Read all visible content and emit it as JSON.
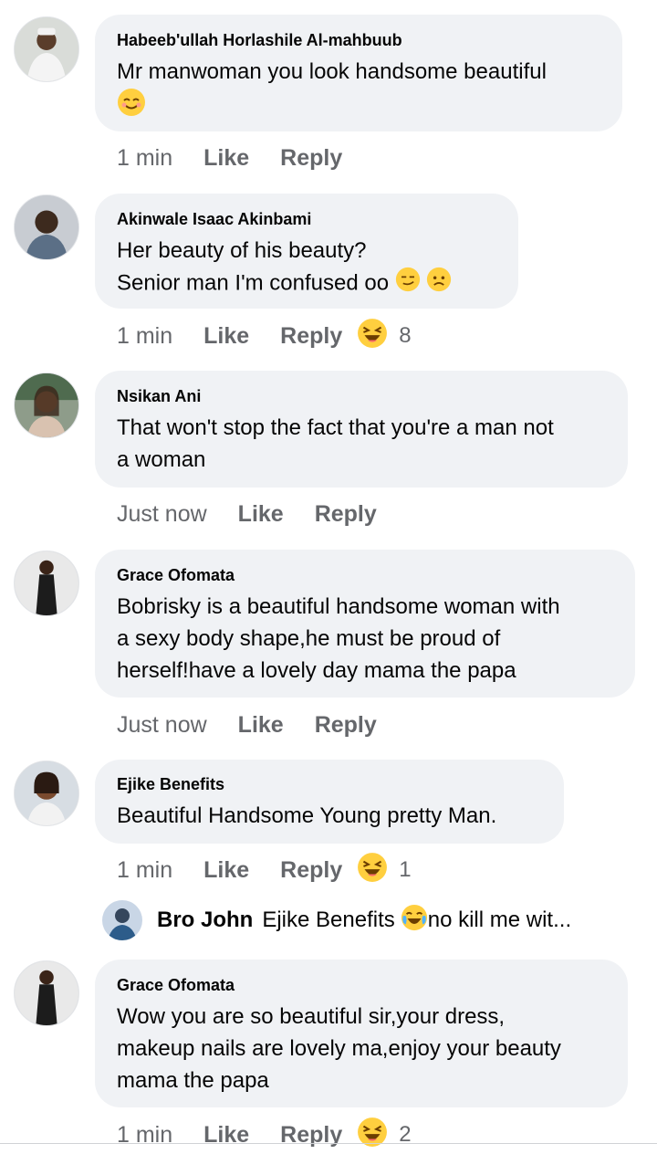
{
  "comments": [
    {
      "author": "Habeeb'ullah Horlashile Al-mahbuub",
      "lines": [
        "Mr manwoman you look handsome beautiful"
      ],
      "time": "1 min",
      "like": "Like",
      "reply": "Reply",
      "reaction_count": "",
      "text_emoji": "smiling-face"
    },
    {
      "author": "Akinwale Isaac Akinbami",
      "lines": [
        "Her beauty of his beauty?",
        " Senior man I'm confused oo"
      ],
      "time": "1 min",
      "like": "Like",
      "reply": "Reply",
      "reaction_count": "8",
      "text_emoji": "smirk-frown"
    },
    {
      "author": "Nsikan Ani",
      "lines": [
        "That won't stop the fact that you're a man not",
        "a woman"
      ],
      "time": "Just now",
      "like": "Like",
      "reply": "Reply",
      "reaction_count": ""
    },
    {
      "author": "Grace Ofomata",
      "lines": [
        "Bobrisky is a beautiful handsome woman with",
        "a sexy body shape,he must be proud of",
        "herself!have a lovely day mama the papa"
      ],
      "time": "Just now",
      "like": "Like",
      "reply": "Reply",
      "reaction_count": ""
    },
    {
      "author": "Ejike Benefits",
      "lines": [
        "Beautiful Handsome Young pretty Man."
      ],
      "time": "1 min",
      "like": "Like",
      "reply": "Reply",
      "reaction_count": "1"
    },
    {
      "author": "Grace Ofomata",
      "lines": [
        "Wow you are so beautiful sir,your dress,",
        "makeup nails are lovely ma,enjoy your beauty",
        "mama the papa"
      ],
      "time": "1 min",
      "like": "Like",
      "reply": "Reply",
      "reaction_count": "2"
    }
  ],
  "reply_preview": {
    "name": "Bro John",
    "mention": "Ejike Benefits",
    "text": "no kill me wit...",
    "emoji": "joy-emoji"
  },
  "colors": {
    "bubble": "#f0f2f5",
    "meta": "#65676b",
    "text": "#050505",
    "emoji": "#ffcf3f"
  }
}
